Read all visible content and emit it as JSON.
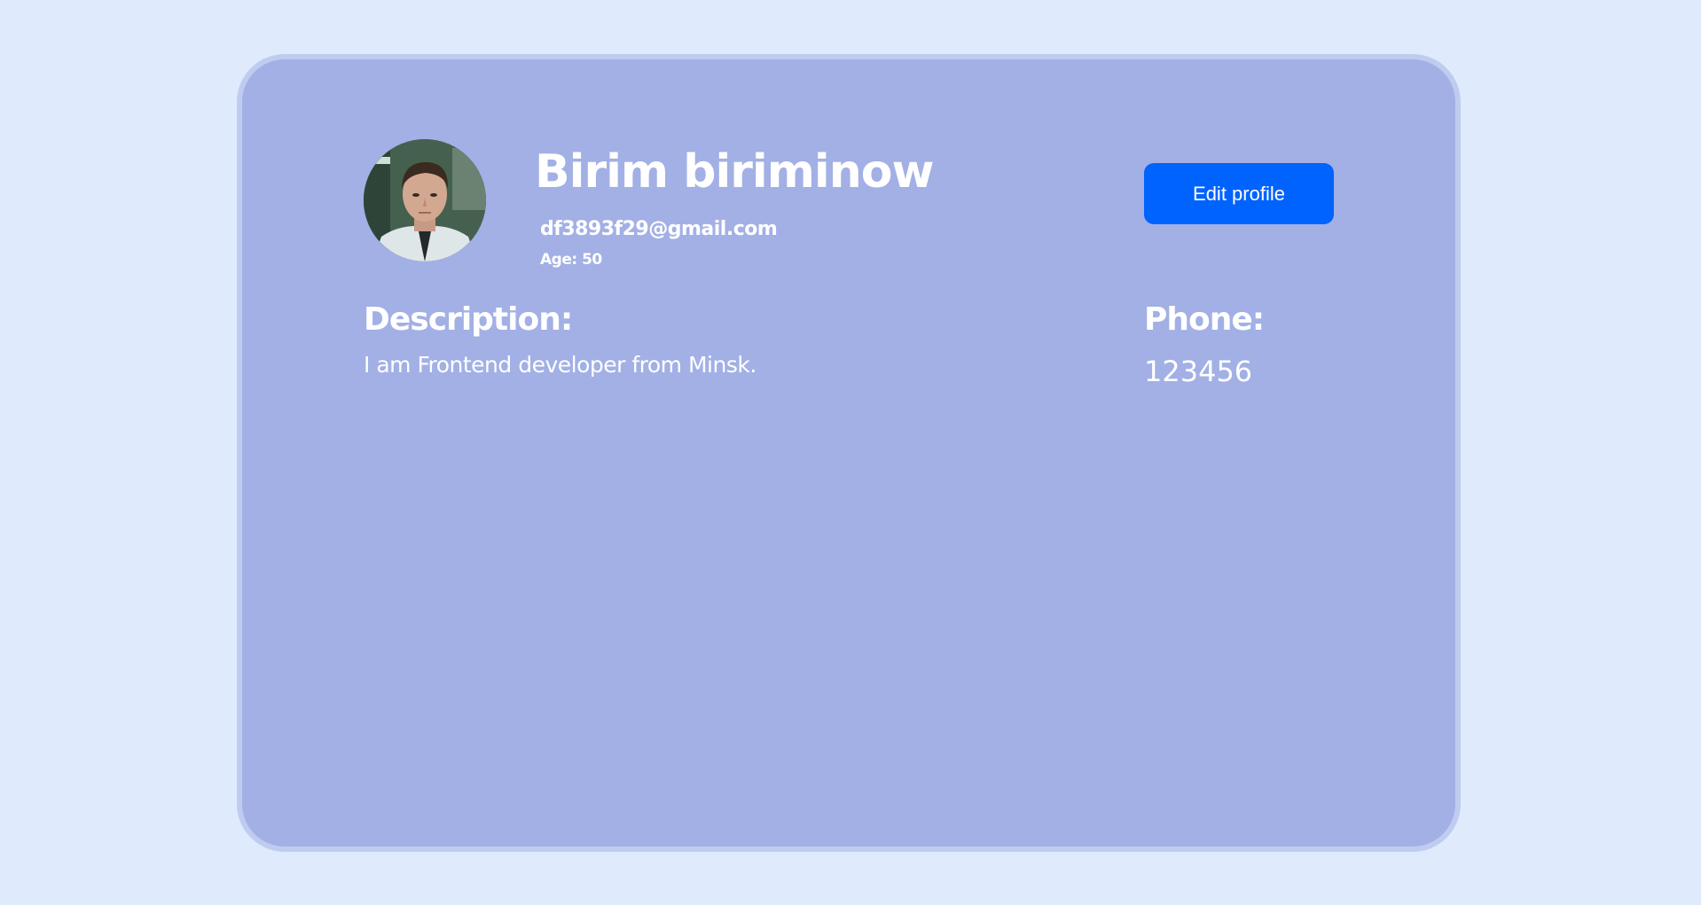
{
  "profile": {
    "name": "Birim biriminow",
    "email": "df3893f29@gmail.com",
    "age": "Age: 50",
    "edit_label": "Edit profile",
    "description_title": "Description:",
    "description": "I am Frontend developer from Minsk.",
    "phone_title": "Phone:",
    "phone": "123456"
  },
  "colors": {
    "page_background": "#dfebfd",
    "card_background": "#a2b0e5",
    "card_border": "#c0ccef",
    "button": "#0063fe",
    "text": "#ffffff"
  }
}
